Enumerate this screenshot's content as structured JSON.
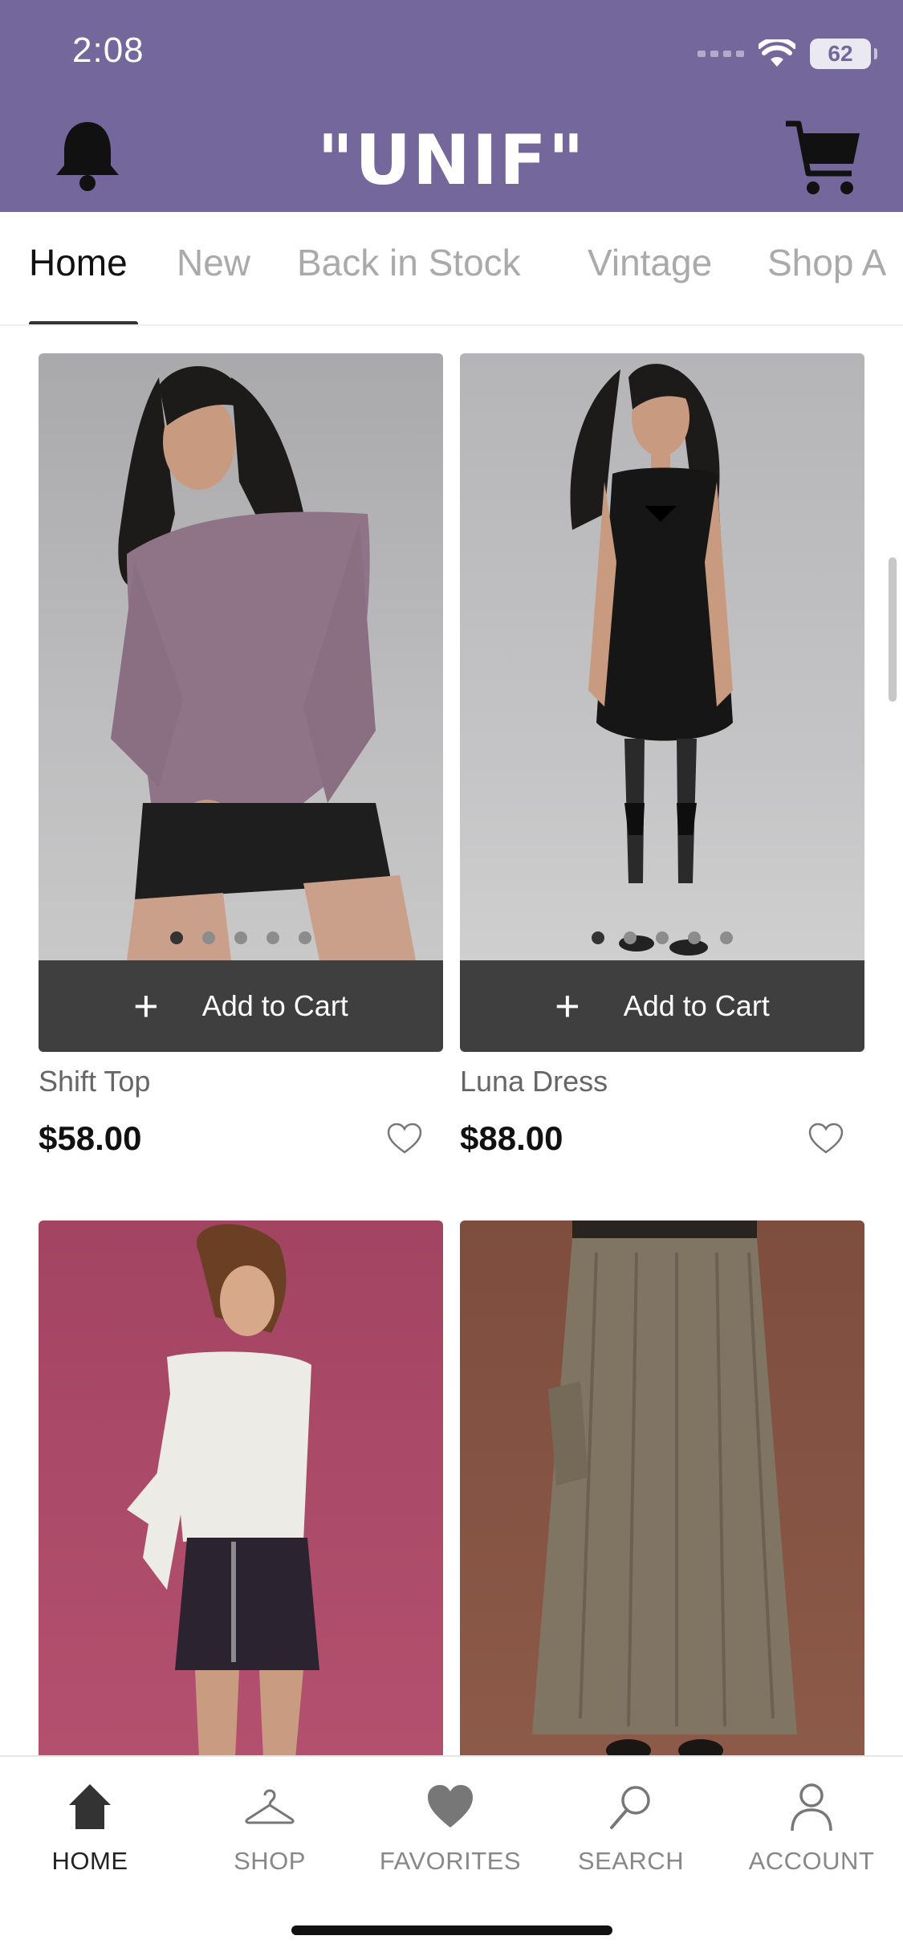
{
  "status": {
    "time": "2:08",
    "battery": "62"
  },
  "header": {
    "brand": "\"UNIF\"",
    "accent_color": "#73679c"
  },
  "tabs": [
    {
      "label": "Home",
      "active": true
    },
    {
      "label": "New",
      "active": false
    },
    {
      "label": "Back in Stock",
      "active": false
    },
    {
      "label": "Vintage",
      "active": false
    },
    {
      "label": "Shop A",
      "active": false
    }
  ],
  "products": [
    {
      "name": "Shift Top",
      "price": "$58.00",
      "add_label": "Add to Cart",
      "image_count": 5,
      "active_image": 0
    },
    {
      "name": "Luna Dress",
      "price": "$88.00",
      "add_label": "Add to Cart",
      "image_count": 5,
      "active_image": 0
    },
    {
      "name": "",
      "price": ""
    },
    {
      "name": "",
      "price": ""
    }
  ],
  "bottom_nav": [
    {
      "label": "HOME",
      "icon": "home-icon",
      "active": true
    },
    {
      "label": "SHOP",
      "icon": "hanger-icon",
      "active": false
    },
    {
      "label": "FAVORITES",
      "icon": "heart-icon",
      "active": false
    },
    {
      "label": "SEARCH",
      "icon": "search-icon",
      "active": false
    },
    {
      "label": "ACCOUNT",
      "icon": "person-icon",
      "active": false
    }
  ]
}
